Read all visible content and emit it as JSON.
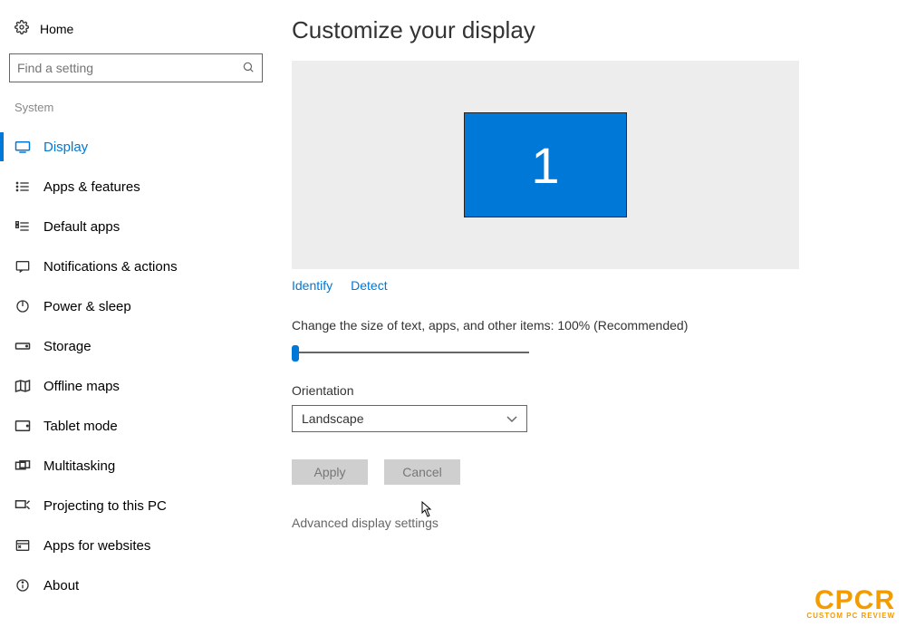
{
  "sidebar": {
    "home_label": "Home",
    "search_placeholder": "Find a setting",
    "section_label": "System",
    "items": [
      {
        "label": "Display"
      },
      {
        "label": "Apps & features"
      },
      {
        "label": "Default apps"
      },
      {
        "label": "Notifications & actions"
      },
      {
        "label": "Power & sleep"
      },
      {
        "label": "Storage"
      },
      {
        "label": "Offline maps"
      },
      {
        "label": "Tablet mode"
      },
      {
        "label": "Multitasking"
      },
      {
        "label": "Projecting to this PC"
      },
      {
        "label": "Apps for websites"
      },
      {
        "label": "About"
      }
    ]
  },
  "main": {
    "title": "Customize your display",
    "monitor_number": "1",
    "identify_label": "Identify",
    "detect_label": "Detect",
    "scale_label": "Change the size of text, apps, and other items: 100% (Recommended)",
    "orientation_label": "Orientation",
    "orientation_value": "Landscape",
    "apply_label": "Apply",
    "cancel_label": "Cancel",
    "advanced_label": "Advanced display settings"
  },
  "watermark": {
    "big": "CPCR",
    "small": "CUSTOM PC REVIEW"
  }
}
